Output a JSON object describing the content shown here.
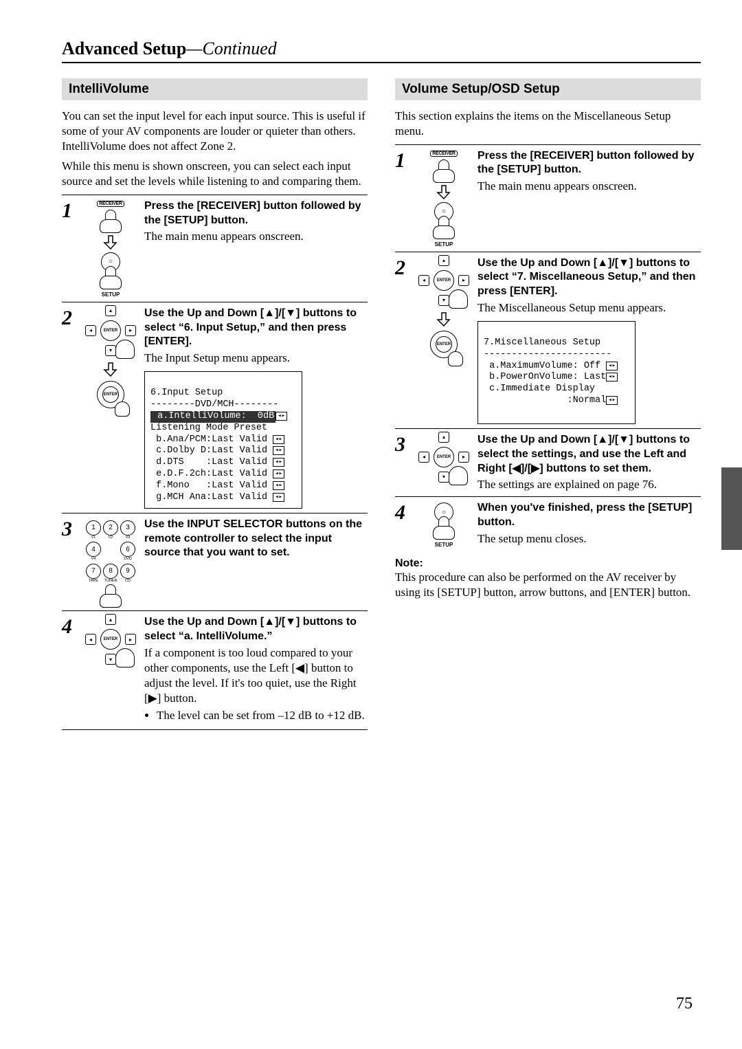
{
  "header": {
    "bold": "Advanced Setup",
    "sep": "—",
    "ital": "Continued"
  },
  "pageNumber": "75",
  "left": {
    "title": "IntelliVolume",
    "intro1": "You can set the input level for each input source. This is useful if some of your AV components are louder or quieter than others. IntelliVolume does not affect Zone 2.",
    "intro2": "While this menu is shown onscreen, you can select each input source and set the levels while listening to and comparing them.",
    "steps": {
      "s1": {
        "num": "1",
        "instr": "Press the [RECEIVER] button followed by the [SETUP] button.",
        "detail": "The main menu appears onscreen."
      },
      "s2": {
        "num": "2",
        "instr": "Use the Up and Down [▲]/[▼] buttons to select “6. Input Setup,” and then press [ENTER].",
        "detail": "The Input Setup menu appears.",
        "lcd": {
          "l1": "6.Input Setup",
          "l2": "--------DVD/MCH--------",
          "l3": " a.IntelliVolume:  0dB",
          "l4": "Listening Mode Preset",
          "l5": " b.Ana/PCM:Last Valid",
          "l6": " c.Dolby D:Last Valid",
          "l7": " d.DTS    :Last Valid",
          "l8": " e.D.F.2ch:Last Valid",
          "l9": " f.Mono   :Last Valid",
          "l10": " g.MCH Ana:Last Valid"
        }
      },
      "s3": {
        "num": "3",
        "instr": "Use the INPUT SELECTOR buttons on the remote controller to select the input source that you want to set."
      },
      "s4": {
        "num": "4",
        "instr": "Use the Up and Down [▲]/[▼] buttons to select “a. IntelliVolume.”",
        "detail": "If a component is too loud compared to your other components, use the Left [◀] button to adjust the level. If it's too quiet, use the Right [▶] button.",
        "bullet": "The level can be set from –12 dB to +12 dB."
      }
    }
  },
  "right": {
    "title": "Volume Setup/OSD Setup",
    "intro": "This section explains the items on the Miscellaneous Setup menu.",
    "steps": {
      "s1": {
        "num": "1",
        "instr": "Press the [RECEIVER] button followed by the [SETUP] button.",
        "detail": "The main menu appears onscreen."
      },
      "s2": {
        "num": "2",
        "instr": "Use the Up and Down [▲]/[▼] buttons to select “7. Miscellaneous Setup,” and then press [ENTER].",
        "detail": "The Miscellaneous Setup menu appears.",
        "lcd": {
          "l1": "7.Miscellaneous Setup",
          "l2": "-----------------------",
          "l3": " a.MaximumVolume: Off",
          "l4": " b.PowerOnVolume: Last",
          "l5": " c.Immediate Display",
          "l6": "               :Normal"
        }
      },
      "s3": {
        "num": "3",
        "instr": "Use the Up and Down [▲]/[▼] buttons to select the settings, and use the Left and Right [◀]/[▶] buttons to set them.",
        "detail": "The settings are explained on page 76."
      },
      "s4": {
        "num": "4",
        "instr": "When you've finished, press the [SETUP] button.",
        "detail": "The setup menu closes."
      }
    },
    "noteLabel": "Note:",
    "note": "This procedure can also be performed on the AV receiver by using its [SETUP] button, arrow buttons, and [ENTER] button."
  },
  "iconLabels": {
    "receiver": "RECEIVER",
    "setup": "SETUP",
    "enter": "ENTER",
    "numLabels": [
      "V1",
      "V2",
      "V3",
      "V4",
      "",
      "DVD",
      "TAPE",
      "TUNER",
      "CD"
    ]
  }
}
